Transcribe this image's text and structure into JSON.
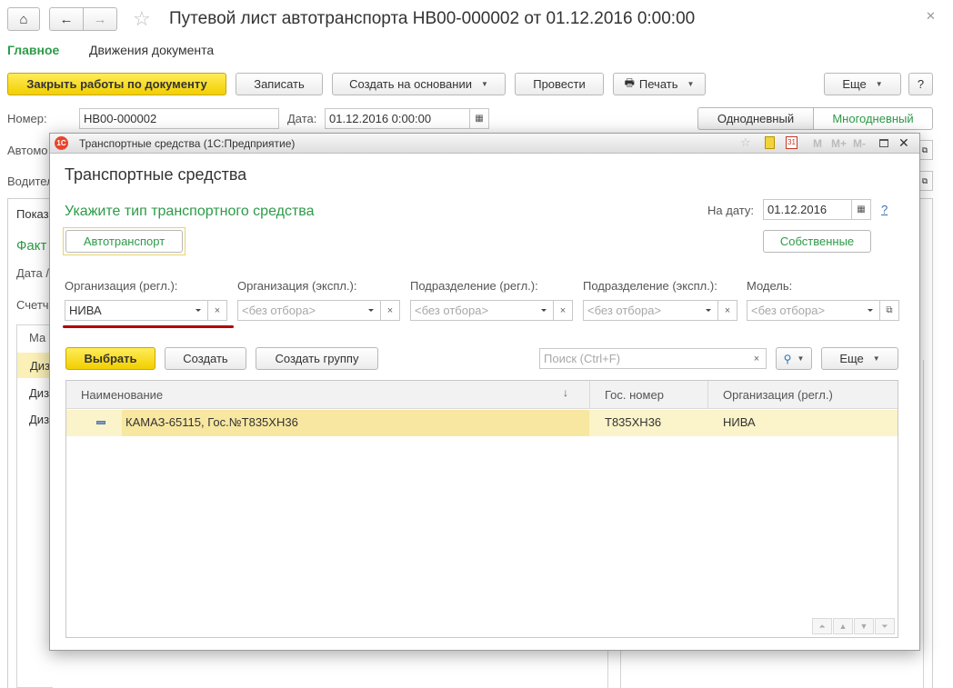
{
  "window": {
    "title": "Путевой лист автотранспорта НВ00-000002 от 01.12.2016 0:00:00"
  },
  "tabs": [
    {
      "label": "Главное"
    },
    {
      "label": "Движения документа"
    }
  ],
  "toolbar": {
    "close_works": "Закрыть работы по документу",
    "write": "Записать",
    "create_based": "Создать на основании",
    "post": "Провести",
    "print": "Печать",
    "more": "Еще",
    "help": "?"
  },
  "doc": {
    "number_label": "Номер:",
    "number_value": "НВ00-000002",
    "date_label": "Дата:",
    "date_value": "01.12.2016  0:00:00",
    "one_day": "Однодневный",
    "multi_day": "Многодневный",
    "auto_label_partial": "Автомо",
    "driver_label_partial": "Водител",
    "tab_partial": "Показ",
    "fact_partial": "Факт",
    "date_partial": "Дата /",
    "counter_partial": "Счетч",
    "col_partial": "Ма",
    "rows_partial": [
      "Диз",
      "Диз",
      "Диз"
    ]
  },
  "modal": {
    "window_title": "Транспортные средства  (1С:Предприятие)",
    "title_icons": [
      "star-icon",
      "calculator-icon",
      "calendar-icon"
    ],
    "title_buttons": [
      "M",
      "M+",
      "M-"
    ],
    "heading": "Транспортные средства",
    "subheading": "Укажите тип транспортного средства",
    "on_date_label": "На дату:",
    "on_date_value": "01.12.2016",
    "help": "?",
    "type_button": "Автотранспорт",
    "own_button": "Собственные",
    "filters": [
      {
        "label": "Организация (регл.):",
        "value": "НИВА",
        "placeholder": false
      },
      {
        "label": "Организация (экспл.):",
        "value": "<без отбора>",
        "placeholder": true
      },
      {
        "label": "Подразделение (регл.):",
        "value": "<без отбора>",
        "placeholder": true
      },
      {
        "label": "Подразделение (экспл.):",
        "value": "<без отбора>",
        "placeholder": true
      },
      {
        "label": "Модель:",
        "value": "<без отбора>",
        "placeholder": true
      }
    ],
    "select_button": "Выбрать",
    "create_button": "Создать",
    "create_group_button": "Создать группу",
    "search_placeholder": "Поиск (Ctrl+F)",
    "more": "Еще",
    "columns": [
      "Наименование",
      "Гос. номер",
      "Организация (регл.)"
    ],
    "rows": [
      {
        "name": "КАМАЗ-65115, Гос.№Т835ХН36",
        "plate": "Т835ХН36",
        "org": "НИВА"
      }
    ]
  },
  "colors": {
    "accent_green": "#2d9b48",
    "button_yellow": "#f5d50c",
    "selection_row": "#fbf0b7",
    "underline_red": "#b30000"
  }
}
